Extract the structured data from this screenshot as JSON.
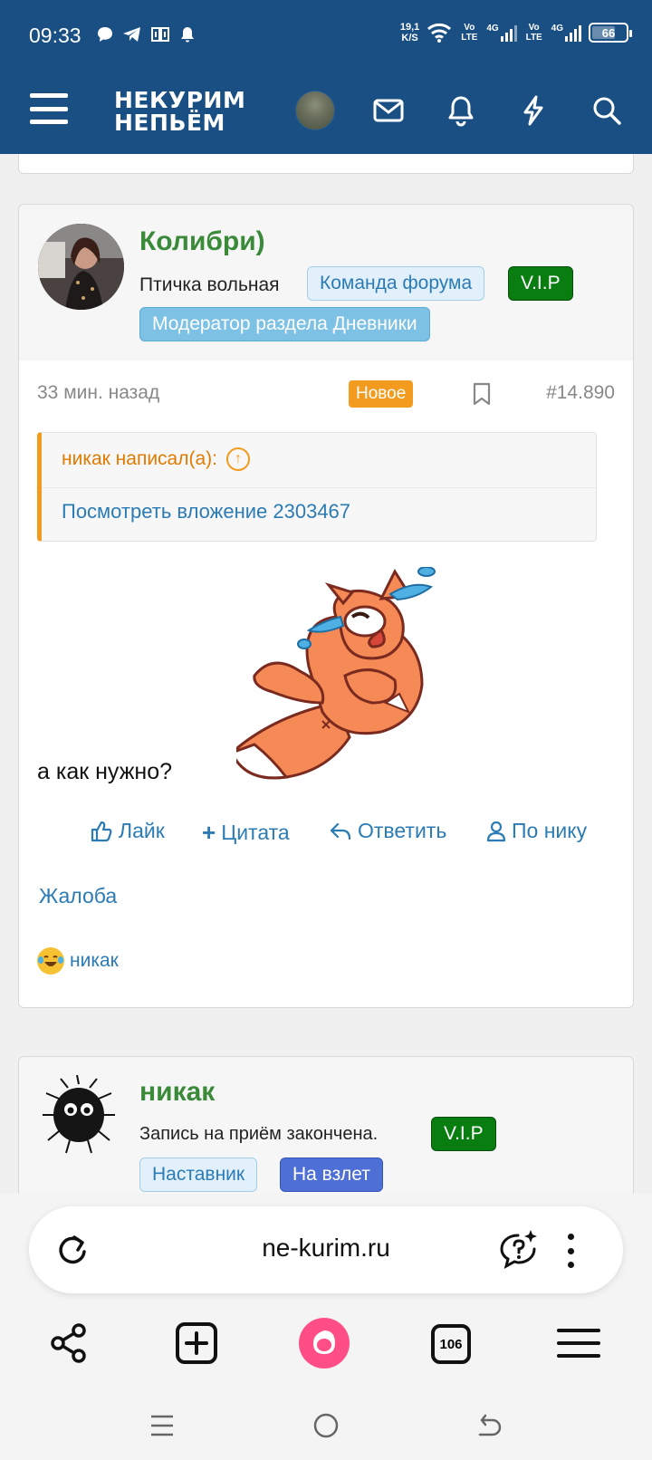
{
  "status_bar": {
    "time": "09:33",
    "speed_value": "19,1",
    "speed_unit": "K/S",
    "network_1": "Vo LTE",
    "network_2": "4G",
    "network_3": "Vo LTE",
    "network_4": "4G",
    "battery": "66",
    "icons_left": [
      "chat-bubble-icon",
      "telegram-icon",
      "app-icon",
      "bell-icon"
    ]
  },
  "forum_header": {
    "logo_line1": "НЕКУРИМ",
    "logo_line2": "НЕПЬЁМ",
    "icons": [
      "menu-icon",
      "user-avatar",
      "mail-icon",
      "bell-icon",
      "bolt-icon",
      "search-icon"
    ],
    "bg_color": "#1a4f83"
  },
  "post": {
    "author": "Колибри)",
    "user_title": "Птичка вольная",
    "badges": [
      "Команда форума",
      "V.I.P",
      "Модератор раздела Дневники"
    ],
    "time": "33 мин. назад",
    "new_label": "Новое",
    "post_number": "#14.890",
    "quote_author": "никак написал(а):",
    "quote_link": "Посмотреть вложение 2303467",
    "message": "а как нужно?",
    "actions": {
      "like": "Лайк",
      "quote": "Цитата",
      "reply": "Ответить",
      "by_nick": "По нику"
    },
    "complaint": "Жалоба",
    "reaction_user": "никак"
  },
  "next_post": {
    "author": "никак",
    "user_title": "Запись на приём закончена.",
    "badges": [
      "V.I.P",
      "Наставник",
      "На взлет"
    ]
  },
  "browser": {
    "url": "ne-kurim.ru",
    "tabs_count": "106",
    "bottom_icons": [
      "share-icon",
      "new-tab-icon",
      "alice-icon",
      "tabs-icon",
      "menu-icon"
    ]
  }
}
